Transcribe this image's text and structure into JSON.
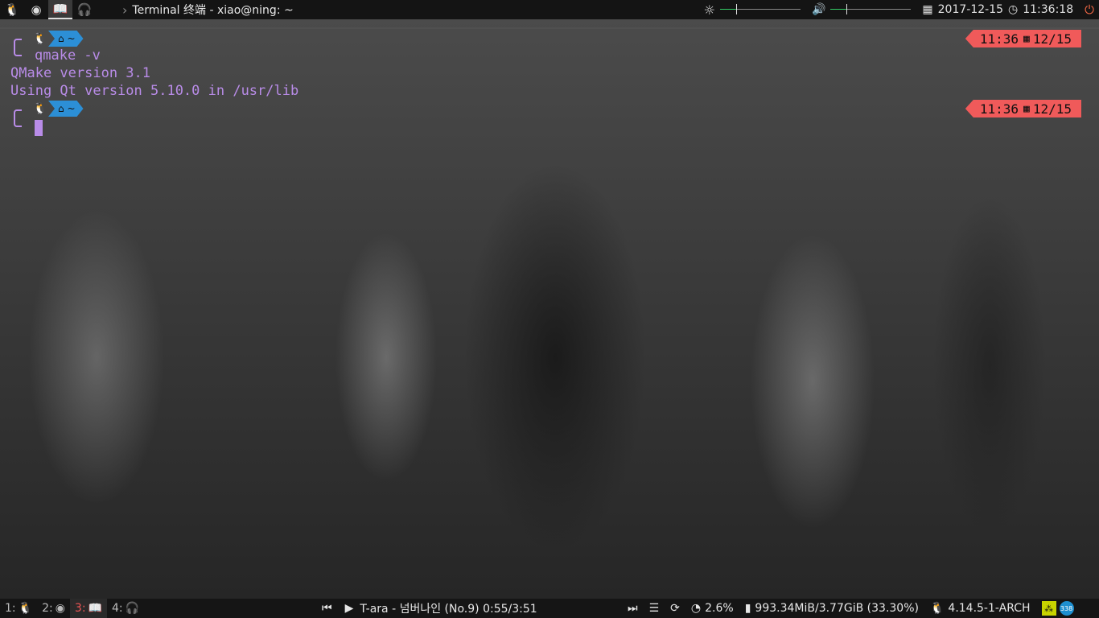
{
  "topbar": {
    "launchers": [
      {
        "name": "tux-icon",
        "glyph": "🐧"
      },
      {
        "name": "firefox-icon",
        "glyph": "◉"
      },
      {
        "name": "book-icon",
        "glyph": "📖"
      },
      {
        "name": "headphones-icon",
        "glyph": "🎧"
      }
    ],
    "window_title": "Terminal 终端 - xiao@ning: ~",
    "date": "2017-12-15",
    "time": "11:36:18",
    "brightness_level": 0.2,
    "volume_level": 0.2
  },
  "terminal": {
    "home_label": "~",
    "lines": {
      "command": "qmake -v",
      "out1": "QMake version 3.1",
      "out2": "Using Qt version 5.10.0 in /usr/lib"
    },
    "rprompt": [
      {
        "time": "11:36",
        "date": "12/15"
      },
      {
        "time": "11:36",
        "date": "12/15"
      }
    ]
  },
  "bottombar": {
    "workspaces": [
      {
        "label": "1:",
        "icon": "🐧"
      },
      {
        "label": "2:",
        "icon": "◉"
      },
      {
        "label": "3:",
        "icon": "📖"
      },
      {
        "label": "4:",
        "icon": "🎧"
      }
    ],
    "player": {
      "track": "T-ara - 넘버나인 (No.9) 0:55/3:51"
    },
    "cpu": "2.6%",
    "memory": "993.34MiB/3.77GiB (33.30%)",
    "kernel": "4.14.5-1-ARCH",
    "tray_badge": "338"
  },
  "colors": {
    "accent_violet": "#b98ce8",
    "home_chip": "#2c8fd6",
    "rprompt_bg": "#f05a5a",
    "active_ws": "#e55555"
  }
}
